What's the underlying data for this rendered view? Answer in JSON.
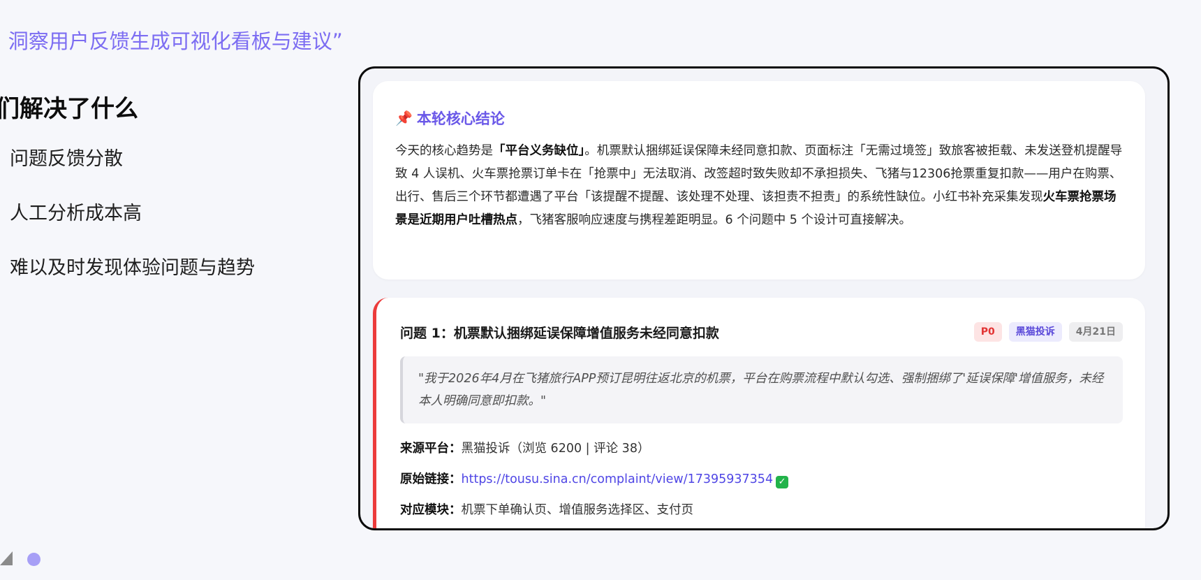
{
  "slide": {
    "title": "I 洞察用户反馈生成可视化看板与建议”",
    "section_heading": "们解决了什么",
    "pain_points": [
      "问题反馈分散",
      "人工分析成本高",
      "难以及时发现体验问题与趋势"
    ]
  },
  "summary": {
    "icon": "pushpin-icon",
    "title": "本轮核心结论",
    "body_parts": [
      {
        "text": "今天的核心趋势是",
        "bold": false
      },
      {
        "text": "「平台义务缺位」",
        "bold": true
      },
      {
        "text": "。机票默认捆绑延误保障未经同意扣款、页面标注「无需过境签」致旅客被拒载、未发送登机提醒导致 4 人误机、火车票抢票订单卡在「抢票中」无法取消、改签超时致失败却不承担损失、飞猪与12306抢票重复扣款——用户在购票、出行、售后三个环节都遭遇了平台「该提醒不提醒、该处理不处理、该担责不担责」的系统性缺位。小红书补充采集发现",
        "bold": false
      },
      {
        "text": "火车票抢票场景是近期用户吐槽热点",
        "bold": true
      },
      {
        "text": "，飞猪客服响应速度与携程差距明显。6 个问题中 5 个设计可直接解决。",
        "bold": false
      }
    ]
  },
  "issue": {
    "title": "问题 1：机票默认捆绑延误保障增值服务未经同意扣款",
    "badges": {
      "priority": "P0",
      "platform": "黑猫投诉",
      "date": "4月21日"
    },
    "accent_color": "#ec3b3b",
    "quote": "\"我于2026年4月在飞猪旅行APP预订昆明往返北京的机票，平台在购票流程中默认勾选、强制捆绑了'延误保障'增值服务，未经本人明确同意即扣款。\"",
    "source": {
      "label": "来源平台：",
      "value": "黑猫投诉（浏览 6200 | 评论 38）"
    },
    "link": {
      "label": "原始链接：",
      "url": "https://tousu.sina.cn/complaint/view/17395937354",
      "icon": "check-mark-icon"
    },
    "module": {
      "label": "对应模块：",
      "value": "机票下单确认页、增值服务选择区、支付页"
    }
  },
  "nav": {
    "prev_icon": "prev-arrow-icon",
    "dot_icon": "page-dot-icon"
  }
}
